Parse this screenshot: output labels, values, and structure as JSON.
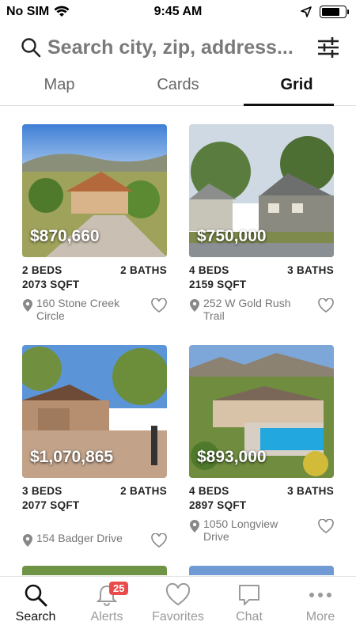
{
  "status": {
    "carrier": "No SIM",
    "time": "9:45 AM"
  },
  "search": {
    "placeholder": "Search city, zip, address..."
  },
  "tabs": [
    {
      "label": "Map"
    },
    {
      "label": "Cards"
    },
    {
      "label": "Grid",
      "active": true
    }
  ],
  "listings": [
    {
      "price": "$870,660",
      "beds": "2 BEDS",
      "baths": "2 BATHS",
      "sqft": "2073 SQFT",
      "address": "160 Stone Creek Circle"
    },
    {
      "price": "$750,000",
      "beds": "4 BEDS",
      "baths": "3 BATHS",
      "sqft": "2159 SQFT",
      "address": "252 W Gold Rush Trail"
    },
    {
      "price": "$1,070,865",
      "beds": "3 BEDS",
      "baths": "2 BATHS",
      "sqft": "2077 SQFT",
      "address": "154 Badger Drive"
    },
    {
      "price": "$893,000",
      "beds": "4 BEDS",
      "baths": "3 BATHS",
      "sqft": "2897 SQFT",
      "address": "1050 Longview Drive"
    }
  ],
  "nav": [
    {
      "label": "Search",
      "icon": "search-icon",
      "active": true
    },
    {
      "label": "Alerts",
      "icon": "bell-icon",
      "badge": "25"
    },
    {
      "label": "Favorites",
      "icon": "heart-icon"
    },
    {
      "label": "Chat",
      "icon": "chat-icon"
    },
    {
      "label": "More",
      "icon": "more-dots-icon"
    }
  ],
  "colors": {
    "accent": "#111111",
    "badge": "#e94b4b",
    "muted": "#9a9a9a"
  }
}
